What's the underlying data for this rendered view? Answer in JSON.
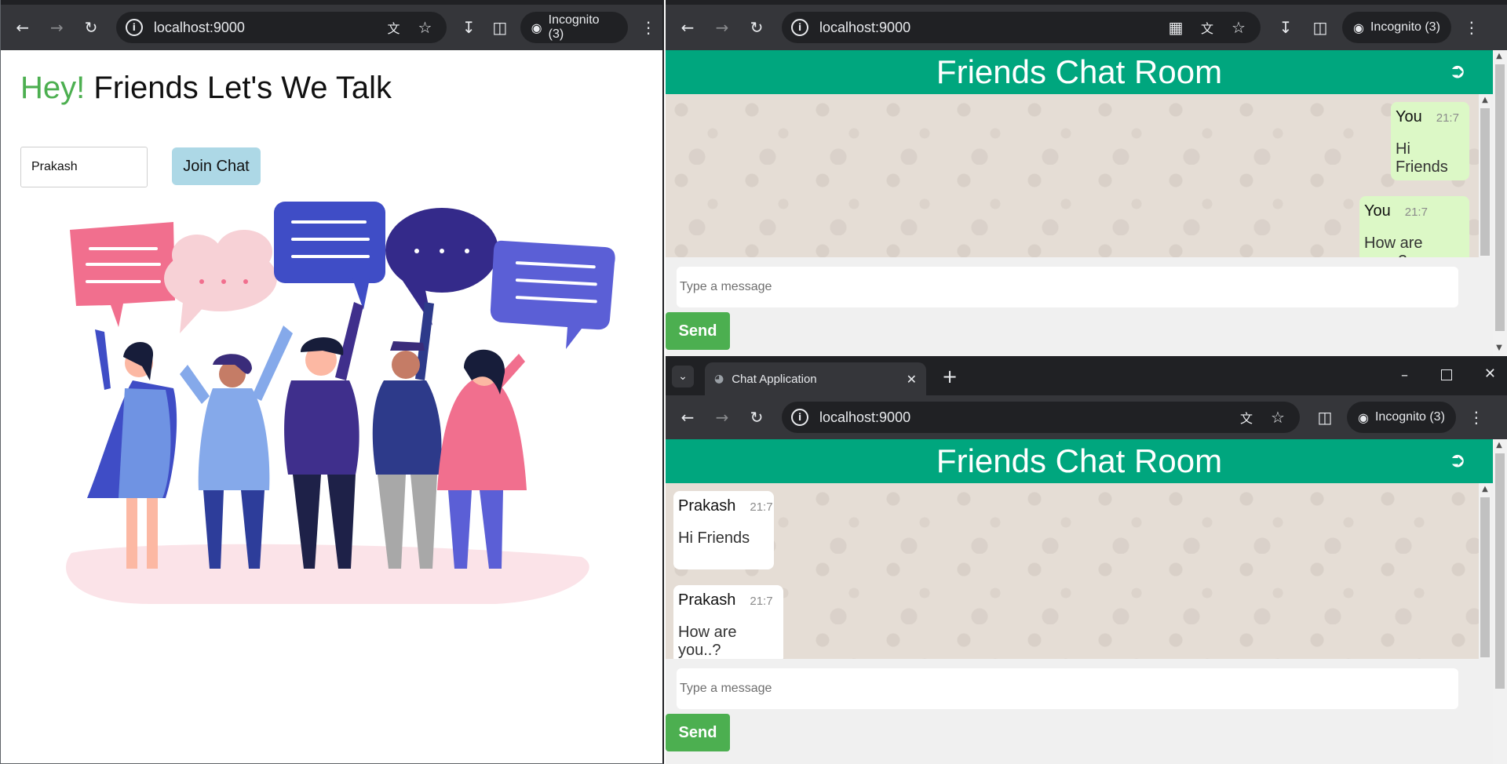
{
  "left_window": {
    "url": "localhost:9000",
    "incognito_label": "Incognito (3)",
    "heading_accent": "Hey!",
    "heading_rest": "Friends Let's We Talk",
    "username_value": "Prakash",
    "join_button": "Join Chat"
  },
  "top_right_window": {
    "url": "localhost:9000",
    "incognito_label": "Incognito (3)",
    "room_title": "Friends Chat Room",
    "messages": [
      {
        "sender": "You",
        "time": "21:7",
        "text": "Hi Friends"
      },
      {
        "sender": "You",
        "time": "21:7",
        "text": "How are you..?"
      }
    ],
    "input_placeholder": "Type a message",
    "send_label": "Send"
  },
  "bottom_right_window": {
    "tab_title": "Chat Application",
    "url": "localhost:9000",
    "incognito_label": "Incognito (3)",
    "room_title": "Friends Chat Room",
    "messages": [
      {
        "sender": "Prakash",
        "time": "21:7",
        "text": "Hi Friends"
      },
      {
        "sender": "Prakash",
        "time": "21:7",
        "text": "How are you..?"
      }
    ],
    "input_placeholder": "Type a message",
    "send_label": "Send"
  },
  "icons": {
    "back": "arrow-left-icon",
    "forward": "arrow-right-icon",
    "reload": "reload-icon",
    "site_info": "info-icon",
    "translate": "translate-icon",
    "bookmark": "star-icon",
    "download": "download-icon",
    "side_panel": "side-panel-icon",
    "menu": "kebab-menu-icon",
    "logout": "logout-icon",
    "qr": "qr-code-icon"
  },
  "colors": {
    "chat_header": "#00a67e",
    "send_button": "#4caf50",
    "own_bubble": "#dcf8c6",
    "join_button": "#add8e6",
    "hey_accent": "#4caf50",
    "browser_toolbar": "#35363a"
  }
}
